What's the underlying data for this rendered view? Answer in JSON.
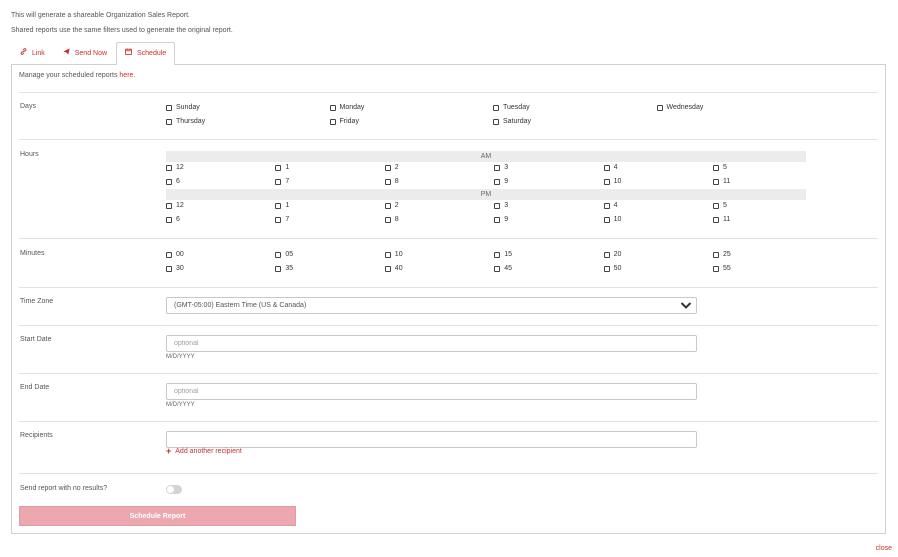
{
  "intro": {
    "line1": "This will generate a shareable Organization Sales Report.",
    "line2": "Shared reports use the same filters used to generate the original report."
  },
  "tabs": [
    {
      "label": "Link",
      "icon": "link-icon"
    },
    {
      "label": "Send Now",
      "icon": "paper-plane-icon"
    },
    {
      "label": "Schedule",
      "icon": "calendar-icon",
      "active": true
    }
  ],
  "manage": {
    "text": "Manage your scheduled reports ",
    "link": "here",
    "suffix": "."
  },
  "days": {
    "label": "Days",
    "options": [
      "Sunday",
      "Monday",
      "Tuesday",
      "Wednesday",
      "Thursday",
      "Friday",
      "Saturday"
    ]
  },
  "hours": {
    "label": "Hours",
    "am_label": "AM",
    "pm_label": "PM",
    "am": [
      "12",
      "1",
      "2",
      "3",
      "4",
      "5",
      "6",
      "7",
      "8",
      "9",
      "10",
      "11"
    ],
    "pm": [
      "12",
      "1",
      "2",
      "3",
      "4",
      "5",
      "6",
      "7",
      "8",
      "9",
      "10",
      "11"
    ]
  },
  "minutes": {
    "label": "Minutes",
    "options": [
      "00",
      "05",
      "10",
      "15",
      "20",
      "25",
      "30",
      "35",
      "40",
      "45",
      "50",
      "55"
    ]
  },
  "timezone": {
    "label": "Time Zone",
    "value": "(GMT-05:00) Eastern Time (US & Canada)"
  },
  "start_date": {
    "label": "Start Date",
    "placeholder": "optional",
    "hint": "M/D/YYYY"
  },
  "end_date": {
    "label": "End Date",
    "placeholder": "optional",
    "hint": "M/D/YYYY"
  },
  "recipients": {
    "label": "Recipients",
    "value": "",
    "add_label": "Add another recipient"
  },
  "no_results": {
    "label": "Send report with no results?",
    "enabled": false
  },
  "submit": {
    "label": "Schedule Report"
  },
  "close_label": "close",
  "colors": {
    "accent": "#c9302c",
    "button_disabled": "#eba8ae"
  }
}
